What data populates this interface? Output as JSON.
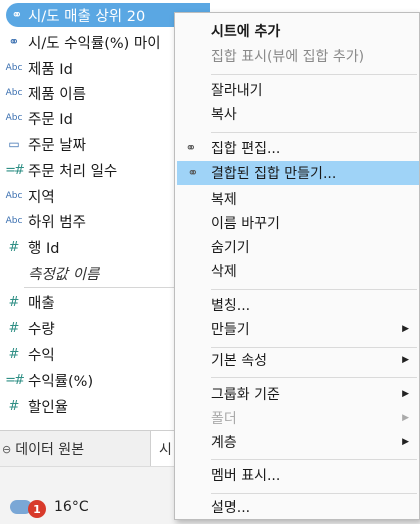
{
  "fields": [
    {
      "icon": "set-icon",
      "label": "시/도 매출 상위 20",
      "selected": true
    },
    {
      "icon": "set-icon",
      "label": "시/도 수익률(%) 마이"
    },
    {
      "icon": "abc-icon",
      "label": "제품 Id"
    },
    {
      "icon": "abc-icon",
      "label": "제품 이름"
    },
    {
      "icon": "abc-icon",
      "label": "주문 Id"
    },
    {
      "icon": "calendar-icon",
      "label": "주문 날짜"
    },
    {
      "icon": "discrete-measure-icon",
      "label": "주문 처리 일수"
    },
    {
      "icon": "abc-icon",
      "label": "지역"
    },
    {
      "icon": "abc-icon",
      "label": "하위 범주"
    },
    {
      "icon": "hash-icon",
      "label": "행 Id"
    },
    {
      "icon": "none",
      "label": "측정값 이름",
      "italic": true
    },
    {
      "icon": "hash-icon",
      "label": "매출"
    },
    {
      "icon": "hash-icon",
      "label": "수량"
    },
    {
      "icon": "hash-icon",
      "label": "수익"
    },
    {
      "icon": "discrete-measure-icon",
      "label": "수익률(%)"
    },
    {
      "icon": "hash-icon",
      "label": "할인율"
    }
  ],
  "tabs": {
    "datasource_label": "데이터 원본",
    "sheet_label": "시"
  },
  "taskbar": {
    "weather_temp": "16°C",
    "badge_count": "1"
  },
  "context_menu": {
    "add_to_sheet": "시트에 추가",
    "show_set": "집합 표시(뷰에 집합 추가)",
    "cut": "잘라내기",
    "copy": "복사",
    "edit_set": "집합 편집...",
    "create_combined_set": "결합된 집합 만들기...",
    "duplicate": "복제",
    "rename": "이름 바꾸기",
    "hide": "숨기기",
    "delete": "삭제",
    "alias": "별칭...",
    "create": "만들기",
    "default_properties": "기본 속성",
    "group_by": "그룹화 기준",
    "folder": "폴더",
    "hierarchy": "계층",
    "show_members": "멤버 표시...",
    "describe": "설명..."
  },
  "colors": {
    "selection": "#5aa7e3",
    "menu_highlight": "#9fd3f7"
  }
}
